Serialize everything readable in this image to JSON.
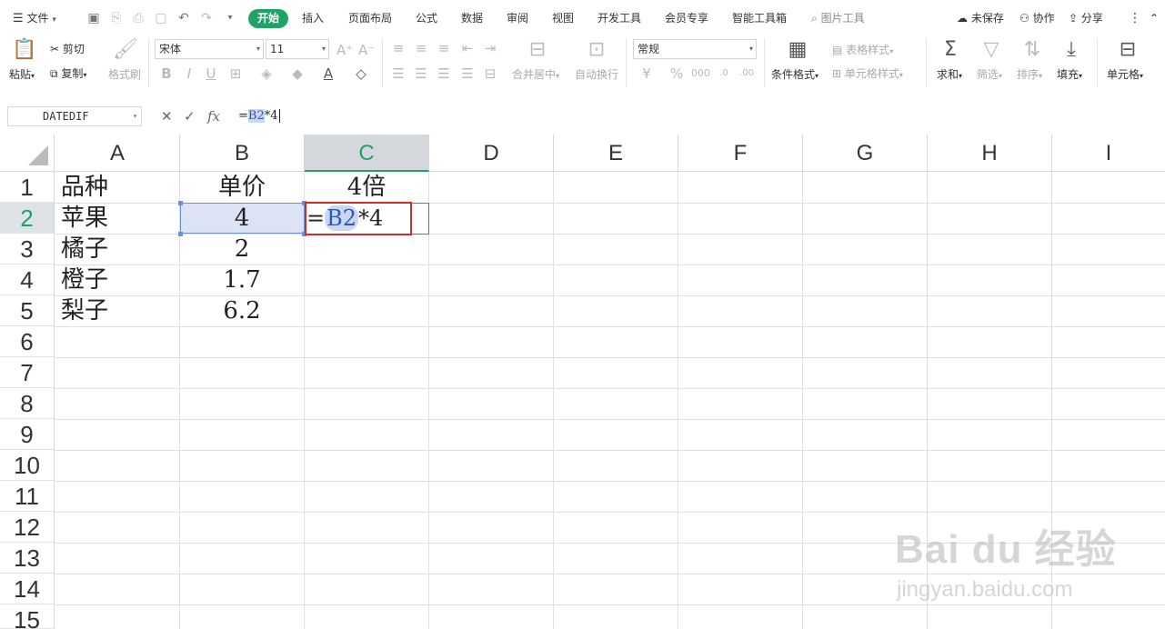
{
  "menubar": {
    "file_label": "文件",
    "tabs": [
      "开始",
      "插入",
      "页面布局",
      "公式",
      "数据",
      "审阅",
      "视图",
      "开发工具",
      "会员专享",
      "智能工具箱"
    ],
    "picture_tools": "图片工具",
    "unsaved": "未保存",
    "collaborate": "协作",
    "share": "分享",
    "accent": "#21a366"
  },
  "ribbon": {
    "paste": "粘贴",
    "cut": "剪切",
    "copy": "复制",
    "format_painter": "格式刷",
    "font_name": "宋体",
    "font_size": "11",
    "merge_center": "合并居中",
    "wrap_text": "自动换行",
    "number_format": "常规",
    "conditional_format": "条件格式",
    "table_style": "表格样式",
    "cell_style": "单元格样式",
    "sum": "求和",
    "filter": "筛选",
    "sort": "排序",
    "fill": "填充",
    "cell": "单元格"
  },
  "formula_bar": {
    "name_box": "DATEDIF",
    "fx": "fx",
    "formula_prefix": "=",
    "formula_ref": "B2",
    "formula_suffix": "*4"
  },
  "grid": {
    "columns": [
      "A",
      "B",
      "C",
      "D",
      "E",
      "F",
      "G",
      "H",
      "I"
    ],
    "rows": [
      "1",
      "2",
      "3",
      "4",
      "5",
      "6",
      "7",
      "8",
      "9",
      "10",
      "11",
      "12",
      "13",
      "14",
      "15"
    ],
    "active_column": "C",
    "active_row": "2",
    "cells": {
      "A1": "品种",
      "B1": "单价",
      "C1": "4倍",
      "A2": "苹果",
      "B2": "4",
      "A3": "橘子",
      "B3": "2",
      "A4": "橙子",
      "B4": "1.7",
      "A5": "梨子",
      "B5": "6.2"
    },
    "editing_cell": {
      "prefix": "=",
      "ref": "B2",
      "suffix": "*4"
    }
  },
  "watermark": {
    "main": "Bai du 经验",
    "sub": "jingyan.baidu.com"
  }
}
